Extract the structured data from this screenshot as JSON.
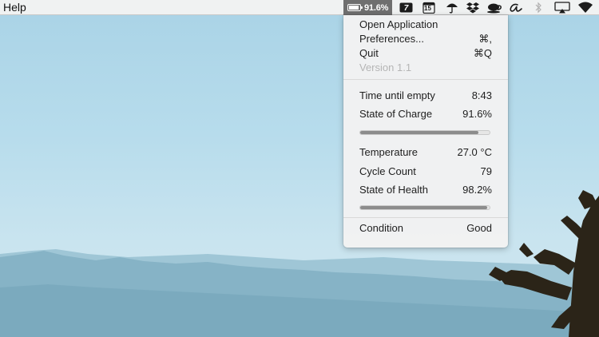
{
  "menubar": {
    "left_menu": "Help",
    "battery_percent": "91.6%",
    "battery_level": 0.916,
    "status_icons": [
      "battery-icon",
      "textexpander-icon",
      "calendar-icon",
      "umbrella-icon",
      "dropbox-icon",
      "coffee-cup-icon",
      "script-a-icon",
      "bluetooth-icon",
      "airplay-icon",
      "wifi-icon"
    ],
    "calendar_day": "15"
  },
  "menu": {
    "items": [
      {
        "label": "Open Application",
        "shortcut": ""
      },
      {
        "label": "Preferences...",
        "shortcut": "⌘,"
      },
      {
        "label": "Quit",
        "shortcut": "⌘Q"
      }
    ],
    "version": "Version 1.1",
    "time_until_empty": {
      "label": "Time until empty",
      "value": "8:43"
    },
    "state_of_charge": {
      "label": "State of Charge",
      "value": "91.6%",
      "level": 0.916
    },
    "temperature": {
      "label": "Temperature",
      "value": "27.0 °C"
    },
    "cycle_count": {
      "label": "Cycle Count",
      "value": "79"
    },
    "state_of_health": {
      "label": "State of Health",
      "value": "98.2%",
      "level": 0.982
    },
    "condition": {
      "label": "Condition",
      "value": "Good"
    }
  },
  "colors": {
    "menubar_highlight": "#6f6f6f",
    "progress_fill": "#8c8c8c",
    "disabled_text": "#b5b5b5"
  }
}
